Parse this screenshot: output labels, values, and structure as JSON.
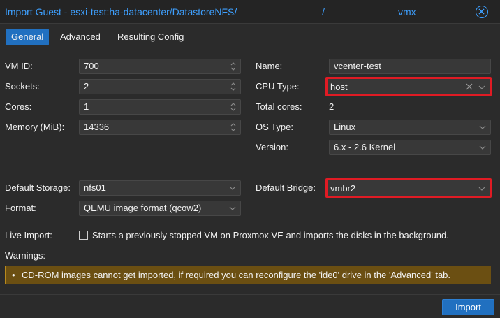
{
  "window": {
    "title": "Import Guest - esxi-test:ha-datacenter/DatastoreNFS/",
    "title_sep": "/",
    "title_end": "vmx"
  },
  "tabs": [
    {
      "label": "General",
      "active": true
    },
    {
      "label": "Advanced",
      "active": false
    },
    {
      "label": "Resulting Config",
      "active": false
    }
  ],
  "general": {
    "vm_id": {
      "label": "VM ID:",
      "value": "700"
    },
    "sockets": {
      "label": "Sockets:",
      "value": "2"
    },
    "cores": {
      "label": "Cores:",
      "value": "1"
    },
    "memory": {
      "label": "Memory (MiB):",
      "value": "14336"
    },
    "name": {
      "label": "Name:",
      "value": "vcenter-test"
    },
    "cpu_type": {
      "label": "CPU Type:",
      "value": "host"
    },
    "total_cores": {
      "label": "Total cores:",
      "value": "2"
    },
    "os_type": {
      "label": "OS Type:",
      "value": "Linux"
    },
    "version": {
      "label": "Version:",
      "value": "6.x - 2.6 Kernel"
    },
    "default_storage": {
      "label": "Default Storage:",
      "value": "nfs01"
    },
    "format": {
      "label": "Format:",
      "value": "QEMU image format (qcow2)"
    },
    "default_bridge": {
      "label": "Default Bridge:",
      "value": "vmbr2"
    },
    "live_import": {
      "label": "Live Import:",
      "checkbox_text": "Starts a previously stopped VM on Proxmox VE and imports the disks in the background."
    },
    "warnings": {
      "label": "Warnings:",
      "items": [
        "CD-ROM images cannot get imported, if required you can reconfigure the 'ide0' drive in the 'Advanced' tab."
      ]
    }
  },
  "footer": {
    "import_label": "Import"
  },
  "colors": {
    "accent": "#2170c0",
    "highlight": "#e01b24",
    "warning_bg": "#6b4f12",
    "title": "#3ea0ff"
  }
}
